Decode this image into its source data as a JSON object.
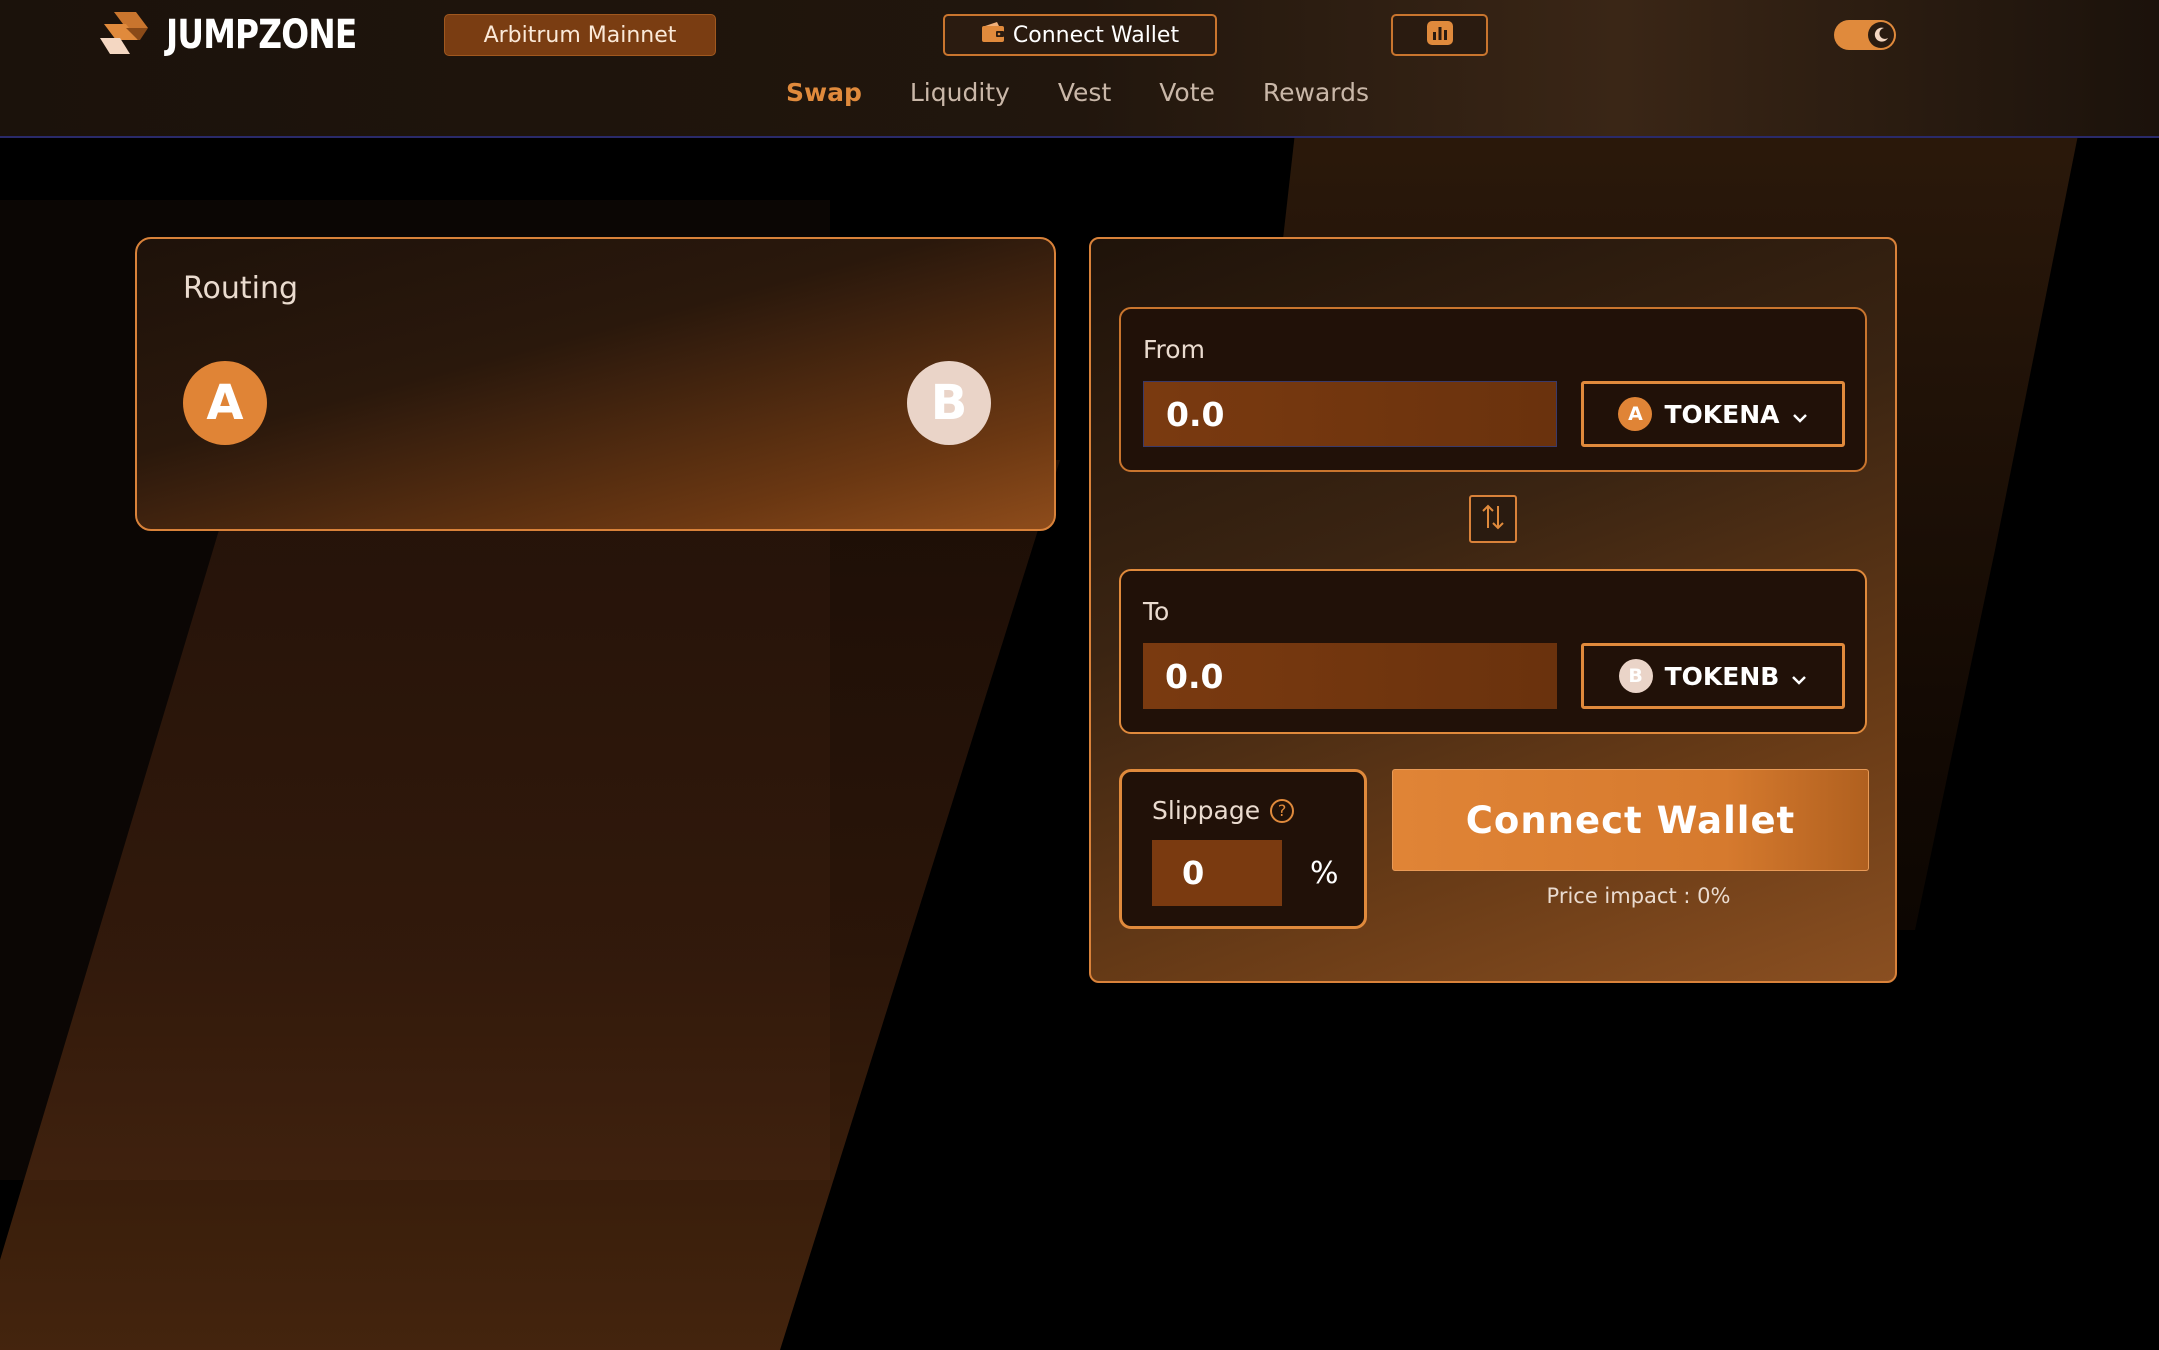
{
  "brand": {
    "name": "JUMPZONE",
    "accent_color": "#e08a3c"
  },
  "header": {
    "network": "Arbitrum Mainnet",
    "connect_wallet": "Connect Wallet",
    "nav": [
      {
        "label": "Swap",
        "active": true
      },
      {
        "label": "Liqudity",
        "active": false
      },
      {
        "label": "Vest",
        "active": false
      },
      {
        "label": "Vote",
        "active": false
      },
      {
        "label": "Rewards",
        "active": false
      }
    ]
  },
  "routing": {
    "title": "Routing",
    "from_node": "A",
    "to_node": "B"
  },
  "swap": {
    "from": {
      "label": "From",
      "amount": "0.0",
      "token": "TOKENA",
      "badge": "A"
    },
    "to": {
      "label": "To",
      "amount": "0.0",
      "token": "TOKENB",
      "badge": "B"
    },
    "slippage": {
      "label": "Slippage",
      "help": "?",
      "value": "0",
      "unit": "%"
    },
    "connect_wallet": "Connect Wallet",
    "price_impact": "Price impact : 0%"
  },
  "icons": {
    "wallet": "wallet-icon",
    "stats": "bar-chart-icon",
    "theme": "moon-icon",
    "switch": "swap-vertical-icon",
    "chevron": "chevron-down-icon"
  }
}
